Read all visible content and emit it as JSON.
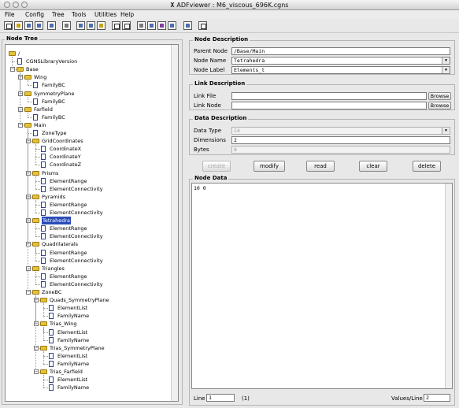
{
  "window": {
    "title": "ADFviewer : M6_viscous_696K.cgns"
  },
  "menubar": {
    "items": [
      "File",
      "Config",
      "Tree",
      "Tools",
      "Utilities",
      "Help"
    ]
  },
  "toolbar": {
    "icons": [
      "new-file",
      "open-folder",
      "save",
      "save-as",
      "properties",
      "print",
      "tree-expand",
      "tree-collapse",
      "tree-scan",
      "search",
      "find-next",
      "config",
      "select-all",
      "color-table",
      "close-file",
      "plot",
      "help"
    ]
  },
  "tree": {
    "title": "Node Tree",
    "nodes": [
      {
        "label": "/",
        "depth": 0,
        "type": "folder",
        "expanded": true
      },
      {
        "label": "CGNSLibraryVersion",
        "depth": 1,
        "type": "leaf"
      },
      {
        "label": "Base",
        "depth": 1,
        "type": "folder",
        "expanded": true
      },
      {
        "label": "Wing",
        "depth": 2,
        "type": "folder",
        "expanded": true
      },
      {
        "label": "FamilyBC",
        "depth": 3,
        "type": "leaf"
      },
      {
        "label": "SymmetryPlane",
        "depth": 2,
        "type": "folder",
        "expanded": true
      },
      {
        "label": "FamilyBC",
        "depth": 3,
        "type": "leaf"
      },
      {
        "label": "Farfield",
        "depth": 2,
        "type": "folder",
        "expanded": true
      },
      {
        "label": "FamilyBC",
        "depth": 3,
        "type": "leaf"
      },
      {
        "label": "Main",
        "depth": 2,
        "type": "folder",
        "expanded": true
      },
      {
        "label": "ZoneType",
        "depth": 3,
        "type": "leaf"
      },
      {
        "label": "GridCoordinates",
        "depth": 3,
        "type": "folder",
        "expanded": true
      },
      {
        "label": "CoordinateX",
        "depth": 4,
        "type": "leaf"
      },
      {
        "label": "CoordinateY",
        "depth": 4,
        "type": "leaf"
      },
      {
        "label": "CoordinateZ",
        "depth": 4,
        "type": "leaf"
      },
      {
        "label": "Prisms",
        "depth": 3,
        "type": "folder",
        "expanded": true
      },
      {
        "label": "ElementRange",
        "depth": 4,
        "type": "leaf"
      },
      {
        "label": "ElementConnectivity",
        "depth": 4,
        "type": "leaf"
      },
      {
        "label": "Pyramids",
        "depth": 3,
        "type": "folder",
        "expanded": true
      },
      {
        "label": "ElementRange",
        "depth": 4,
        "type": "leaf"
      },
      {
        "label": "ElementConnectivity",
        "depth": 4,
        "type": "leaf"
      },
      {
        "label": "Tetrahedra",
        "depth": 3,
        "type": "folder",
        "expanded": true,
        "selected": true
      },
      {
        "label": "ElementRange",
        "depth": 4,
        "type": "leaf"
      },
      {
        "label": "ElementConnectivity",
        "depth": 4,
        "type": "leaf"
      },
      {
        "label": "Quadrilaterals",
        "depth": 3,
        "type": "folder",
        "expanded": true
      },
      {
        "label": "ElementRange",
        "depth": 4,
        "type": "leaf"
      },
      {
        "label": "ElementConnectivity",
        "depth": 4,
        "type": "leaf"
      },
      {
        "label": "Triangles",
        "depth": 3,
        "type": "folder",
        "expanded": true
      },
      {
        "label": "ElementRange",
        "depth": 4,
        "type": "leaf"
      },
      {
        "label": "ElementConnectivity",
        "depth": 4,
        "type": "leaf"
      },
      {
        "label": "ZoneBC",
        "depth": 3,
        "type": "folder",
        "expanded": true
      },
      {
        "label": "Quads_SymmetryPlane",
        "depth": 4,
        "type": "folder",
        "expanded": true
      },
      {
        "label": "ElementList",
        "depth": 5,
        "type": "leaf"
      },
      {
        "label": "FamilyName",
        "depth": 5,
        "type": "leaf"
      },
      {
        "label": "Trias_Wing",
        "depth": 4,
        "type": "folder",
        "expanded": true
      },
      {
        "label": "ElementList",
        "depth": 5,
        "type": "leaf"
      },
      {
        "label": "FamilyName",
        "depth": 5,
        "type": "leaf"
      },
      {
        "label": "Trias_SymmetryPlane",
        "depth": 4,
        "type": "folder",
        "expanded": true
      },
      {
        "label": "ElementList",
        "depth": 5,
        "type": "leaf"
      },
      {
        "label": "FamilyName",
        "depth": 5,
        "type": "leaf"
      },
      {
        "label": "Trias_Farfield",
        "depth": 4,
        "type": "folder",
        "expanded": true
      },
      {
        "label": "ElementList",
        "depth": 5,
        "type": "leaf"
      },
      {
        "label": "FamilyName",
        "depth": 5,
        "type": "leaf"
      }
    ]
  },
  "node_description": {
    "title": "Node Description",
    "parent_node_label": "Parent Node",
    "parent_node_value": "/Base/Main",
    "node_name_label": "Node Name",
    "node_name_value": "Tetrahedra",
    "node_label_label": "Node Label",
    "node_label_value": "Elements_t"
  },
  "link_description": {
    "title": "Link Description",
    "link_file_label": "Link File",
    "link_file_value": "",
    "link_node_label": "Link Node",
    "link_node_value": "",
    "browse_label": "Browse"
  },
  "data_description": {
    "title": "Data Description",
    "data_type_label": "Data Type",
    "data_type_value": "I4",
    "dimensions_label": "Dimensions",
    "dimensions_value": "2",
    "bytes_label": "Bytes",
    "bytes_value": "8"
  },
  "actions": {
    "create": "create",
    "modify": "modify",
    "read": "read",
    "clear": "clear",
    "delete": "delete"
  },
  "node_data": {
    "title": "Node Data",
    "content": "10 0",
    "line_label": "Line",
    "line_value": "1",
    "line_total": "(1)",
    "values_per_line_label": "Values/Line",
    "values_per_line_value": "2"
  }
}
